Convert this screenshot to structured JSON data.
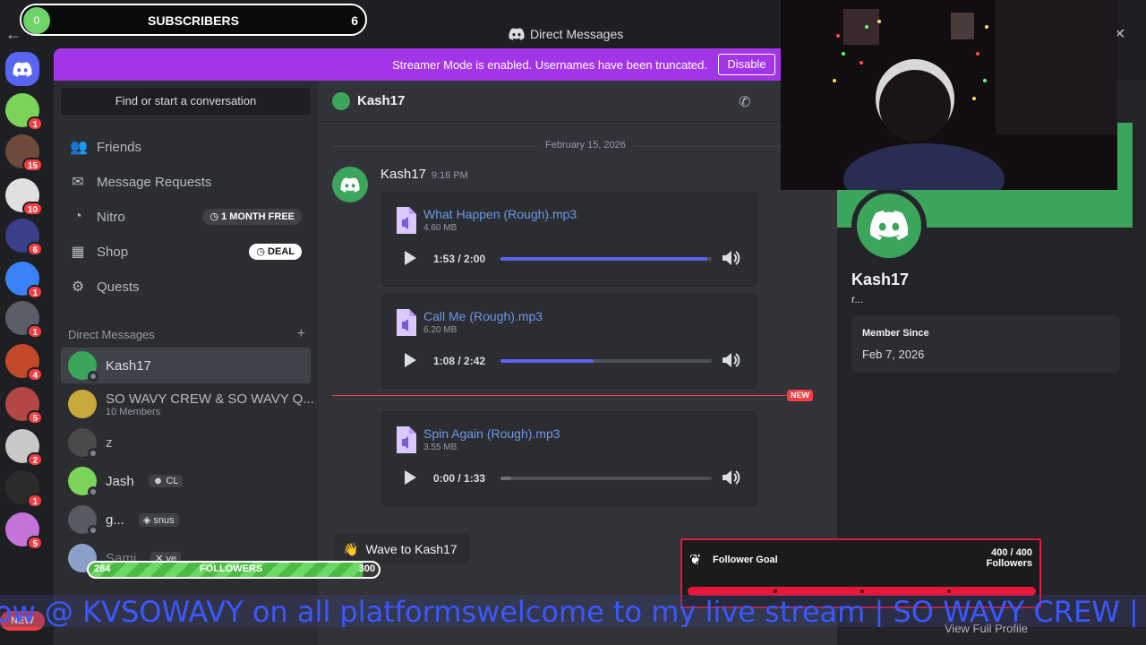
{
  "window": {
    "title": "Direct Messages"
  },
  "servers": [
    {
      "badge": "1",
      "color": "#7bd35a"
    },
    {
      "badge": "15",
      "color": "#6d4a3c"
    },
    {
      "badge": "10",
      "color": "#e0e0e0"
    },
    {
      "badge": "6",
      "color": "#3a3f8a"
    },
    {
      "badge": "1",
      "color": "#3b82f6"
    },
    {
      "badge": "1",
      "color": "#5b5e66"
    },
    {
      "badge": "4",
      "color": "#c24a2a"
    },
    {
      "badge": "5",
      "color": "#b44646"
    },
    {
      "badge": "2",
      "color": "#c8c8c8"
    },
    {
      "badge": "1",
      "color": "#2b2b2b"
    },
    {
      "badge": "5",
      "color": "#c474d8"
    }
  ],
  "rail": {
    "new_label": "NEW"
  },
  "banner": {
    "text": "Streamer Mode is enabled. Usernames have been truncated.",
    "button": "Disable"
  },
  "sidebar": {
    "search": "Find or start a conversation",
    "nav": [
      {
        "label": "Friends",
        "icon": "friends-icon"
      },
      {
        "label": "Message Requests",
        "icon": "mail-icon"
      },
      {
        "label": "Nitro",
        "icon": "nitro-icon",
        "pill": "1 MONTH FREE"
      },
      {
        "label": "Shop",
        "icon": "shop-icon",
        "pill": "DEAL"
      },
      {
        "label": "Quests",
        "icon": "quests-icon"
      }
    ],
    "section": "Direct Messages",
    "dms": [
      {
        "name": "Kash17",
        "sub": ""
      },
      {
        "name": "SO WAVY CREW & SO WAVY Q...",
        "sub": "10 Members"
      },
      {
        "name": "z",
        "sub": ""
      },
      {
        "name": "Jash",
        "tag": "CL"
      },
      {
        "name": "g...",
        "tag": "snus"
      },
      {
        "name": "Sami",
        "tag": "ve"
      }
    ]
  },
  "chat": {
    "recipient": "Kash17",
    "date": "February 15, 2026",
    "author": "Kash17",
    "time": "9:16 PM",
    "attachments": [
      {
        "name": "What Happen (Rough).mp3",
        "size": "4.60 MB",
        "time": "1:53 / 2:00",
        "progress": 0.98
      },
      {
        "name": "Call Me (Rough).mp3",
        "size": "6.20 MB",
        "time": "1:08 / 2:42",
        "progress": 0.44
      },
      {
        "name": "Spin Again (Rough).mp3",
        "size": "3.55 MB",
        "time": "0:00 / 1:33",
        "progress": 0.05
      }
    ],
    "new_label": "NEW",
    "wave": "Wave to Kash17"
  },
  "profile": {
    "name": "Kash17",
    "note": "r...",
    "member_since_label": "Member Since",
    "member_since": "Feb 7, 2026",
    "full_profile": "View Full Profile"
  },
  "overlay": {
    "subs_current": "0",
    "subs_label": "SUBSCRIBERS",
    "subs_goal": "6",
    "followers_current": "284",
    "followers_label": "FOLLOWERS",
    "followers_goal": "300",
    "goal_title": "Follower Goal",
    "goal_count": "400 / 400",
    "goal_unit": "Followers",
    "ticker": "ow @ KVSOWAVY on all platformswelcome to my live stream | SO WAVY CREW  | fo"
  },
  "userbar": {
    "name": "kv2Tadded"
  }
}
